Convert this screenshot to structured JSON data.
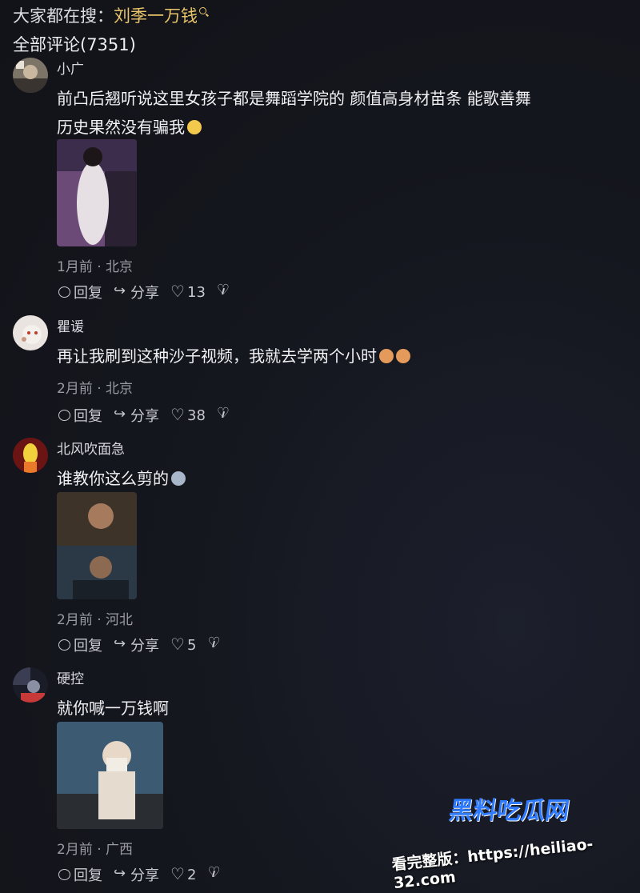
{
  "header": {
    "search_prefix": "大家都在搜：",
    "search_keyword": "刘季一万钱",
    "comment_count": "全部评论(7351)"
  },
  "actions": {
    "reply": "回复",
    "share": "分享"
  },
  "comments": [
    {
      "user": "小广",
      "text_line1": "前凸后翘听说这里女孩子都是舞蹈学院的 颜值高身材苗条 能歌善舞",
      "text_line2": "历史果然没有骗我",
      "meta": "1月前 · 北京",
      "likes": "13"
    },
    {
      "user": "瞿谖",
      "text_line1": "再让我刷到这种沙子视频，我就去学两个小时",
      "meta": "2月前 · 北京",
      "likes": "38"
    },
    {
      "user": "北风吹面急",
      "text_line1": "谁教你这么剪的",
      "meta": "2月前 · 河北",
      "likes": "5"
    },
    {
      "user": "硬控",
      "text_line1": "就你喊一万钱啊",
      "meta": "2月前 · 广西",
      "likes": "2"
    }
  ],
  "watermark": {
    "brand": "黑料吃瓜网",
    "line": "看完整版：https://heiliao-32.com"
  },
  "colors": {
    "keyword": "#e8c46a",
    "background": "#15171f",
    "watermark": "#2f7bff"
  }
}
